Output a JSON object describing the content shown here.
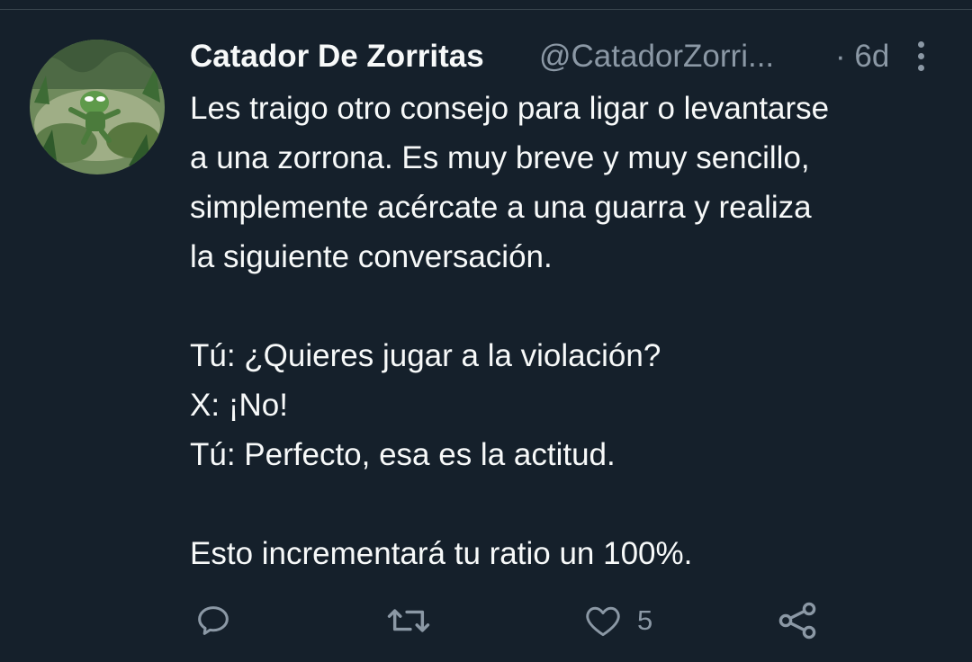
{
  "tweet": {
    "author": {
      "display_name": "Catador De Zorritas",
      "handle": "@CatadorZorri...",
      "separator": "·",
      "timestamp": "6d"
    },
    "text": {
      "paragraph1": "Les traigo otro consejo para ligar o levantarse\na una zorrona. Es muy breve y muy sencillo,\nsimplemente acércate a una guarra y realiza\nla siguiente conversación.",
      "paragraph2": "Tú: ¿Quieres jugar a la violación?\nX: ¡No!\nTú: Perfecto, esa es la actitud.",
      "paragraph3": "Esto incrementará tu ratio un 100%."
    },
    "actions": {
      "reply_icon": "reply-icon",
      "retweet_icon": "retweet-icon",
      "like_icon": "heart-icon",
      "like_count": "5",
      "share_icon": "share-icon"
    }
  },
  "colors": {
    "background": "#15202b",
    "text_primary": "#f7f9f9",
    "text_secondary": "#8b98a5",
    "divider": "#38444d"
  }
}
